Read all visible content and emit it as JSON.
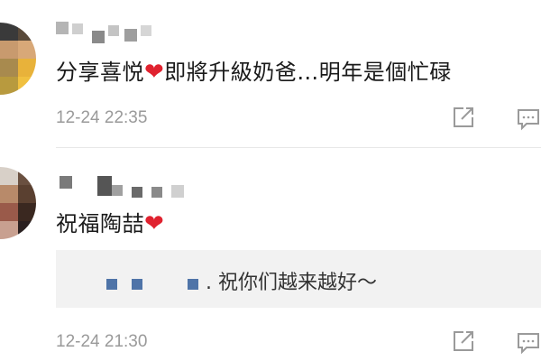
{
  "comments": [
    {
      "text_before": "分享喜悦",
      "heart": "❤",
      "text_after": "即將升級奶爸…明年是個忙碌",
      "time": "12-24 22:35",
      "actions": {
        "share_icon": "share-icon",
        "reply_icon": "comment-icon"
      }
    },
    {
      "text_before": "祝福陶喆",
      "heart": "❤",
      "time": "12-24 21:30",
      "reply": {
        "text": ". 祝你们越来越好～"
      },
      "actions": {
        "share_icon": "share-icon",
        "reply_icon": "comment-icon"
      }
    }
  ],
  "colors": {
    "heart": "#e0222f",
    "timestamp": "#9a9a9a",
    "reply_bg": "#f2f2f2",
    "reply_name_blocks": "#4f74a8"
  }
}
